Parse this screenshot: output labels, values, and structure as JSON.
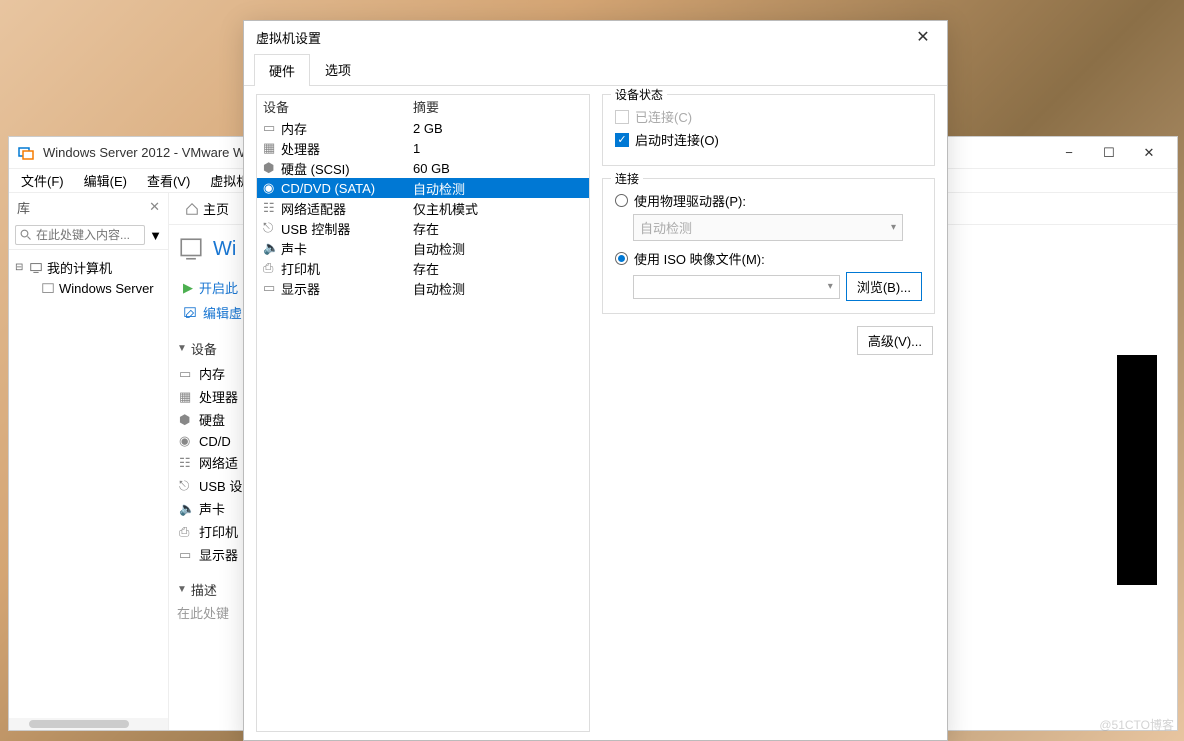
{
  "vmware": {
    "title": "Windows Server 2012 - VMware W",
    "menus": [
      "文件(F)",
      "编辑(E)",
      "查看(V)",
      "虚拟机(M)"
    ],
    "library_label": "库",
    "search_placeholder": "在此处键入内容...",
    "tree_root": "我的计算机",
    "tree_child": "Windows Server",
    "home_tab": "主页",
    "vm_name": "Wi",
    "action_power": "开启此",
    "action_edit": "编辑虚",
    "section_devices": "设备",
    "hw_items": [
      "内存",
      "处理器",
      "硬盘",
      "CD/D",
      "网络适",
      "USB 设",
      "声卡",
      "打印机",
      "显示器"
    ],
    "section_desc": "描述",
    "desc_placeholder": "在此处键"
  },
  "dialog": {
    "title": "虚拟机设置",
    "tabs": [
      "硬件",
      "选项"
    ],
    "col_device": "设备",
    "col_summary": "摘要",
    "devices": [
      {
        "name": "内存",
        "summary": "2 GB"
      },
      {
        "name": "处理器",
        "summary": "1"
      },
      {
        "name": "硬盘 (SCSI)",
        "summary": "60 GB"
      },
      {
        "name": "CD/DVD (SATA)",
        "summary": "自动检测"
      },
      {
        "name": "网络适配器",
        "summary": "仅主机模式"
      },
      {
        "name": "USB 控制器",
        "summary": "存在"
      },
      {
        "name": "声卡",
        "summary": "自动检测"
      },
      {
        "name": "打印机",
        "summary": "存在"
      },
      {
        "name": "显示器",
        "summary": "自动检测"
      }
    ],
    "status_label": "设备状态",
    "chk_connected": "已连接(C)",
    "chk_connect_start": "启动时连接(O)",
    "connect_label": "连接",
    "radio_physical": "使用物理驱动器(P):",
    "physical_auto": "自动检测",
    "radio_iso": "使用 ISO 映像文件(M):",
    "browse_btn": "浏览(B)...",
    "advanced_btn": "高级(V)..."
  },
  "watermark": "@51CTO博客"
}
